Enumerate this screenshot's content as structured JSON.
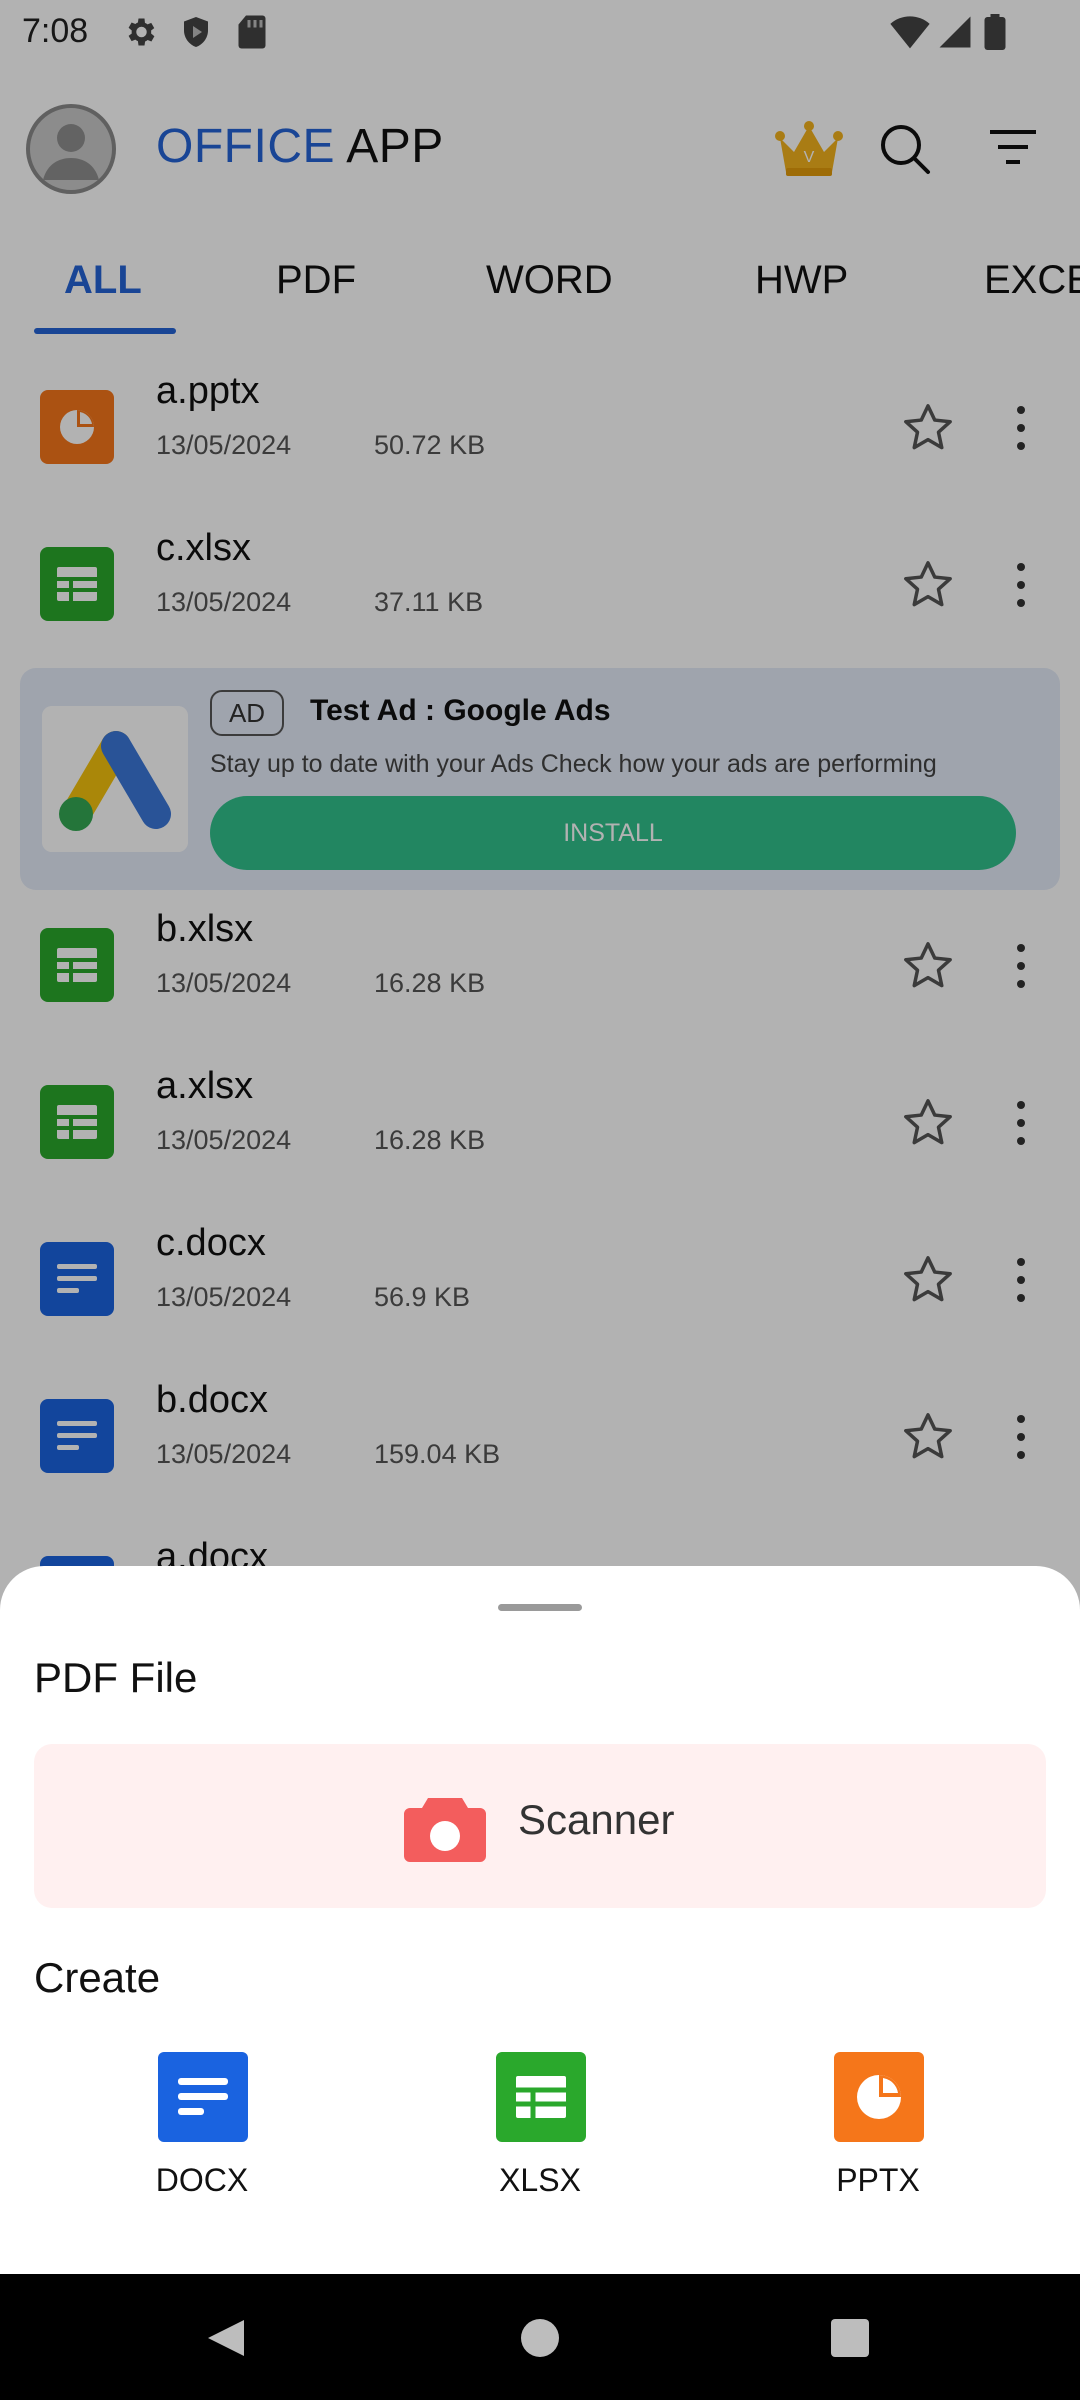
{
  "status_bar": {
    "time": "7:08"
  },
  "header": {
    "title_part1": "OFFICE",
    "title_part2": "APP",
    "premium_badge_letter": "V"
  },
  "tabs": [
    {
      "label": "ALL",
      "active": true
    },
    {
      "label": "PDF"
    },
    {
      "label": "WORD"
    },
    {
      "label": "HWP"
    },
    {
      "label": "EXCEL"
    }
  ],
  "files": [
    {
      "name": "a.pptx",
      "date": "13/05/2024",
      "size": "50.72 KB",
      "type": "pptx"
    },
    {
      "name": "c.xlsx",
      "date": "13/05/2024",
      "size": "37.11 KB",
      "type": "xlsx"
    },
    {
      "name": "b.xlsx",
      "date": "13/05/2024",
      "size": "16.28 KB",
      "type": "xlsx"
    },
    {
      "name": "a.xlsx",
      "date": "13/05/2024",
      "size": "16.28 KB",
      "type": "xlsx"
    },
    {
      "name": "c.docx",
      "date": "13/05/2024",
      "size": "56.9 KB",
      "type": "docx"
    },
    {
      "name": "b.docx",
      "date": "13/05/2024",
      "size": "159.04 KB",
      "type": "docx"
    },
    {
      "name": "a.docx",
      "date": "",
      "size": "",
      "type": "docx"
    }
  ],
  "ad": {
    "badge": "AD",
    "title": "Test Ad : Google Ads",
    "description": "Stay up to date with your Ads Check how your ads are performing",
    "cta": "INSTALL"
  },
  "bottom_sheet": {
    "section1_title": "PDF File",
    "scanner_label": "Scanner",
    "section2_title": "Create",
    "create_items": [
      {
        "label": "DOCX",
        "color": "#1a63e0"
      },
      {
        "label": "XLSX",
        "color": "#2aa82c"
      },
      {
        "label": "PPTX",
        "color": "#f5761a"
      }
    ]
  },
  "colors": {
    "accent": "#2563d6",
    "pptx": "#f5761a",
    "xlsx": "#2aa82c",
    "docx": "#1a63e0",
    "install": "#32c18c"
  }
}
